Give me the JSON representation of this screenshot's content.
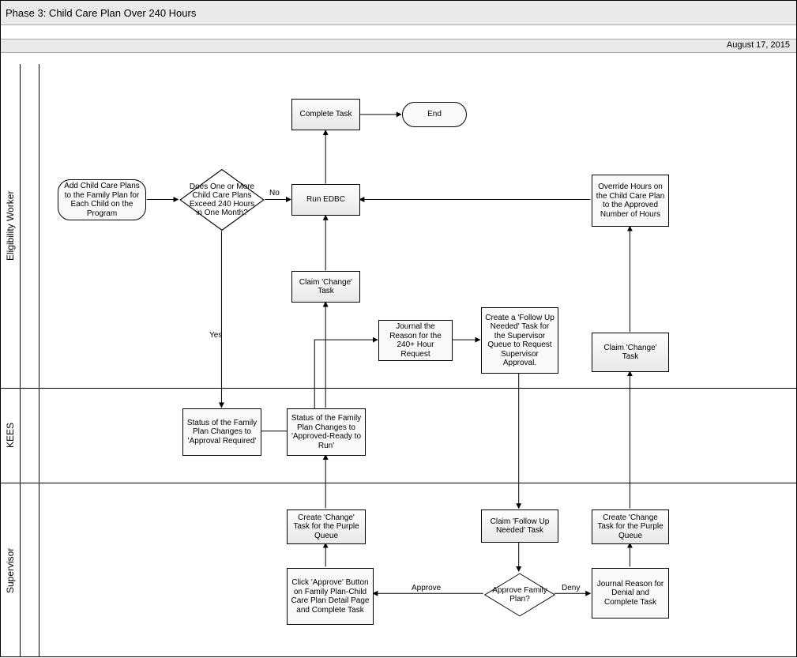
{
  "header": {
    "title": "Phase 3:  Child Care Plan Over 240 Hours",
    "date": "August 17, 2015"
  },
  "lanes": {
    "eligibility_worker": "Eligibility Worker",
    "kees": "KEES",
    "supervisor": "Supervisor"
  },
  "nodes": {
    "start": "Add Child Care Plans to the Family Plan for Each Child on the Program",
    "decision1": "Does One or More Child Care Plans Exceed 240 Hours in One Month?",
    "run_edbc": "Run EDBC",
    "complete_task": "Complete Task",
    "end": "End",
    "claim_change": "Claim 'Change' Task",
    "journal_reason": "Journal the Reason for the 240+ Hour Request",
    "create_followup": "Create a 'Follow Up Needed' Task for the Supervisor Queue to Request Supervisor Approval.",
    "override_hours": "Override Hours on the Child Care Plan to the Approved Number of Hours",
    "claim_change2": "Claim 'Change' Task",
    "status_approval_required": "Status of the Family Plan Changes to 'Approval Required'",
    "status_approved_ready": "Status of the Family Plan Changes to 'Approved-Ready to Run'",
    "create_change_purple": "Create 'Change' Task for the Purple Queue",
    "click_approve": "Click 'Approve' Button on Family Plan-Child Care Plan Detail Page and Complete Task",
    "claim_followup": "Claim 'Follow Up Needed' Task",
    "decision2": "Approve Family Plan?",
    "create_change_purple2": "Create 'Change Task for the Purple Queue",
    "journal_denial": "Journal Reason for Denial and Complete Task"
  },
  "edges": {
    "no": "No",
    "yes": "Yes",
    "approve": "Approve",
    "deny": "Deny"
  }
}
